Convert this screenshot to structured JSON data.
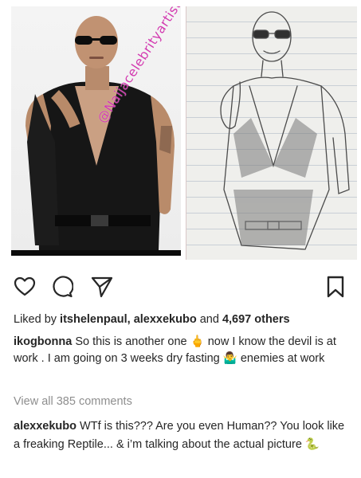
{
  "media": {
    "watermark": "@Naijacelebrityartist"
  },
  "icons": {
    "like": "heart-icon",
    "comment": "comment-icon",
    "share": "paper-plane-icon",
    "save": "bookmark-icon"
  },
  "likes": {
    "prefix": "Liked by ",
    "users": "itshelenpaul, alexxekubo",
    "middle": " and ",
    "count_text": "4,697 others"
  },
  "caption": {
    "username": "ikogbonna",
    "text": " So this is another one 🖕 now I know the devil is at work . I am going on 3 weeks dry fasting 🤷‍♂️ enemies at work"
  },
  "comments": {
    "view_all": "View all 385 comments",
    "items": [
      {
        "username": "alexxekubo",
        "text": " WTf is this??? Are you even Human?? You look like a freaking Reptile... & i’m talking about the actual picture 🐍"
      }
    ]
  },
  "colors": {
    "text": "#262626",
    "muted": "#8e8e8e",
    "watermark": "#d23bb0"
  }
}
